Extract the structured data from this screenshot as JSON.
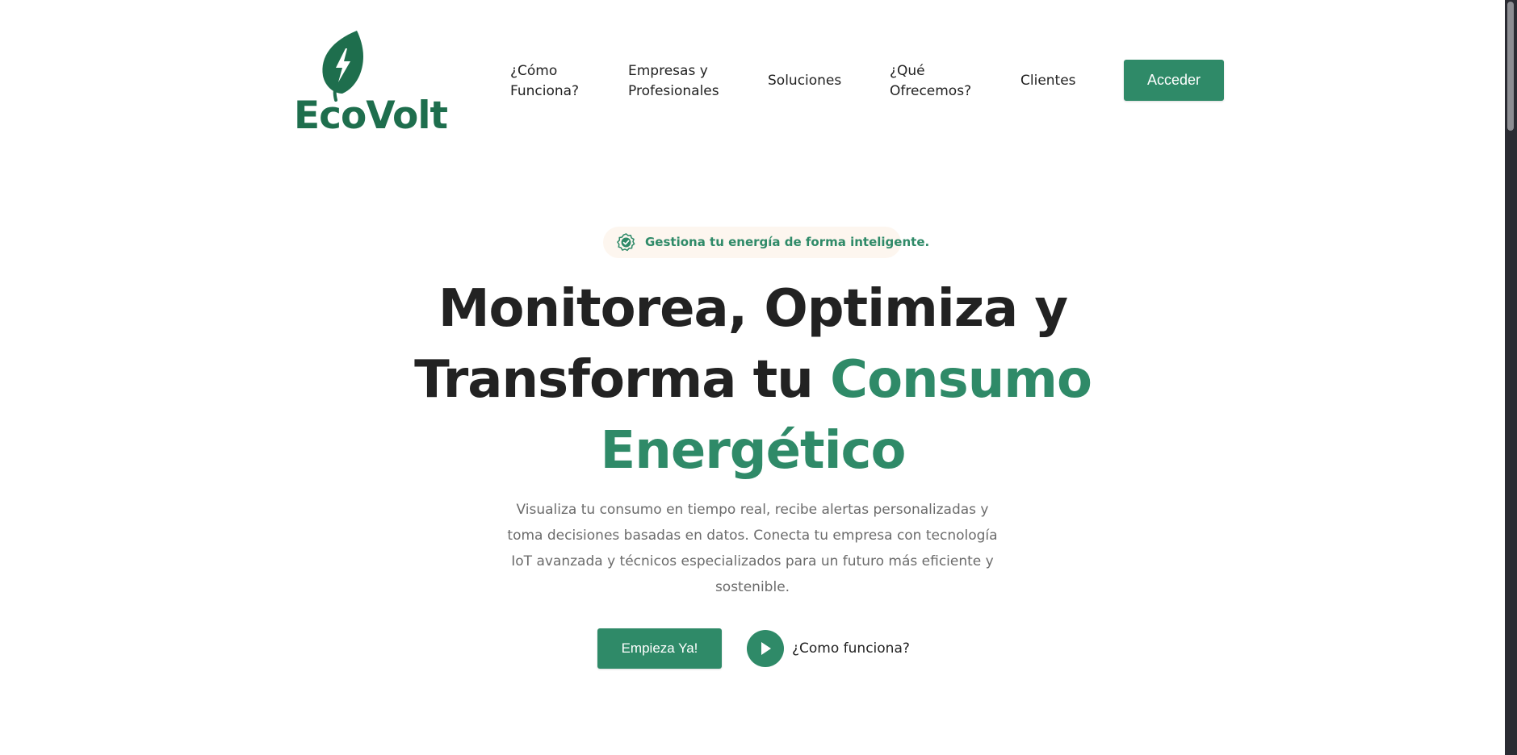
{
  "brand": {
    "name": "EcoVolt",
    "logo_icon": "leaf-bolt-icon",
    "color": "#1e6e4d"
  },
  "nav": {
    "items": [
      {
        "label": "¿Cómo Funciona?"
      },
      {
        "label": "Empresas y Profesionales"
      },
      {
        "label": "Soluciones"
      },
      {
        "label": "¿Qué Ofrecemos?"
      },
      {
        "label": "Clientes"
      }
    ],
    "access_label": "Acceder"
  },
  "hero": {
    "badge_icon": "check-badge-icon",
    "badge_text": "Gestiona tu energía de forma inteligente.",
    "title_dark": "Monitorea, Optimiza y Transforma tu",
    "title_accent": "Consumo Energético",
    "description": "Visualiza tu consumo en tiempo real, recibe alertas personalizadas y toma decisiones basadas en datos. Conecta tu empresa con tecnología IoT avanzada y técnicos especializados para un futuro más eficiente y sostenible.",
    "cta_label": "Empieza Ya!",
    "secondary_icon": "play-icon",
    "secondary_label": "¿Como funciona?"
  },
  "colors": {
    "accent": "#2f8a68",
    "text_dark": "#222222",
    "text_muted": "#6b6b6b",
    "badge_bg": "#fdf6ef"
  }
}
